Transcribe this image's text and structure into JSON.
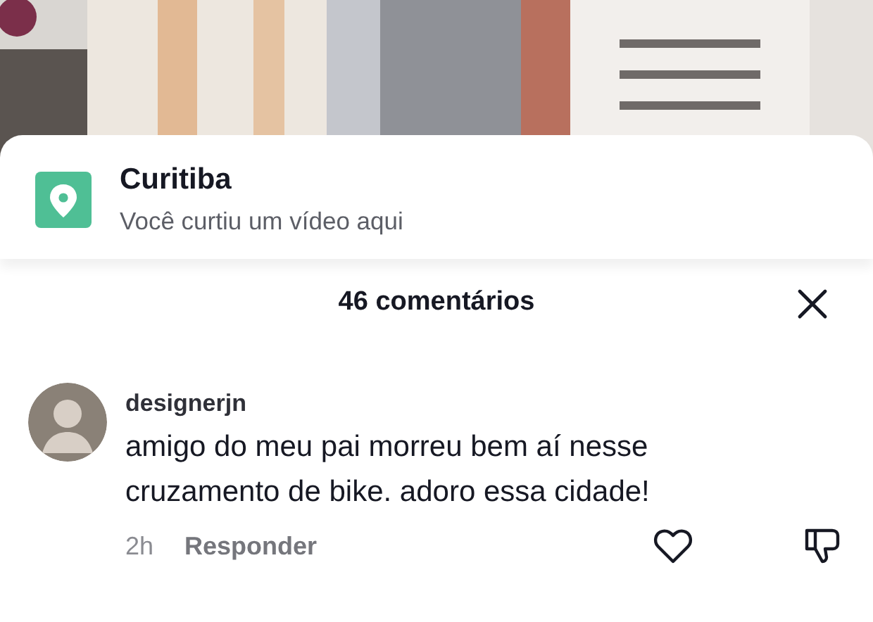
{
  "location_card": {
    "name": "Curitiba",
    "subtitle": "Você curtiu um vídeo aqui"
  },
  "comments_header": {
    "title": "46 comentários"
  },
  "comments": [
    {
      "username": "designerjn",
      "text": "amigo do meu pai morreu bem aí nesse cruzamento de bike. adoro essa cidade!",
      "time": "2h",
      "reply_label": "Responder",
      "liked": false,
      "disliked": false
    }
  ]
}
